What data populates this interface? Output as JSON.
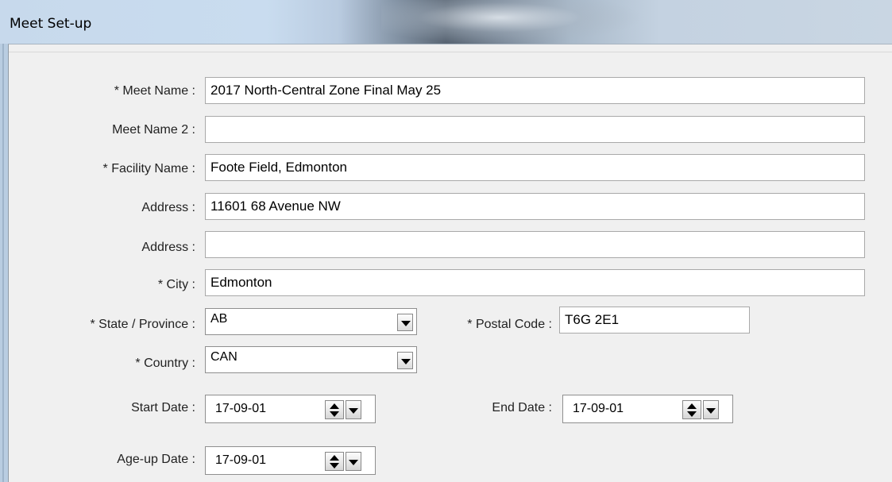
{
  "window": {
    "title": "Meet Set-up"
  },
  "form": {
    "meet_name": {
      "label": "* Meet Name :",
      "value": "2017 North-Central Zone Final May 25"
    },
    "meet_name_2": {
      "label": "Meet Name 2 :",
      "value": ""
    },
    "facility_name": {
      "label": "* Facility Name :",
      "value": "Foote Field, Edmonton"
    },
    "address_1": {
      "label": "Address :",
      "value": "11601 68 Avenue NW"
    },
    "address_2": {
      "label": "Address :",
      "value": ""
    },
    "city": {
      "label": "* City :",
      "value": "Edmonton"
    },
    "state_province": {
      "label": "* State / Province :",
      "value": "AB"
    },
    "postal_code": {
      "label": "* Postal Code :",
      "value": "T6G 2E1"
    },
    "country": {
      "label": "* Country :",
      "value": "CAN"
    },
    "start_date": {
      "label": "Start Date :",
      "value": "17-09-01"
    },
    "end_date": {
      "label": "End Date :",
      "value": "17-09-01"
    },
    "age_up_date": {
      "label": "Age-up Date :",
      "value": "17-09-01"
    }
  }
}
